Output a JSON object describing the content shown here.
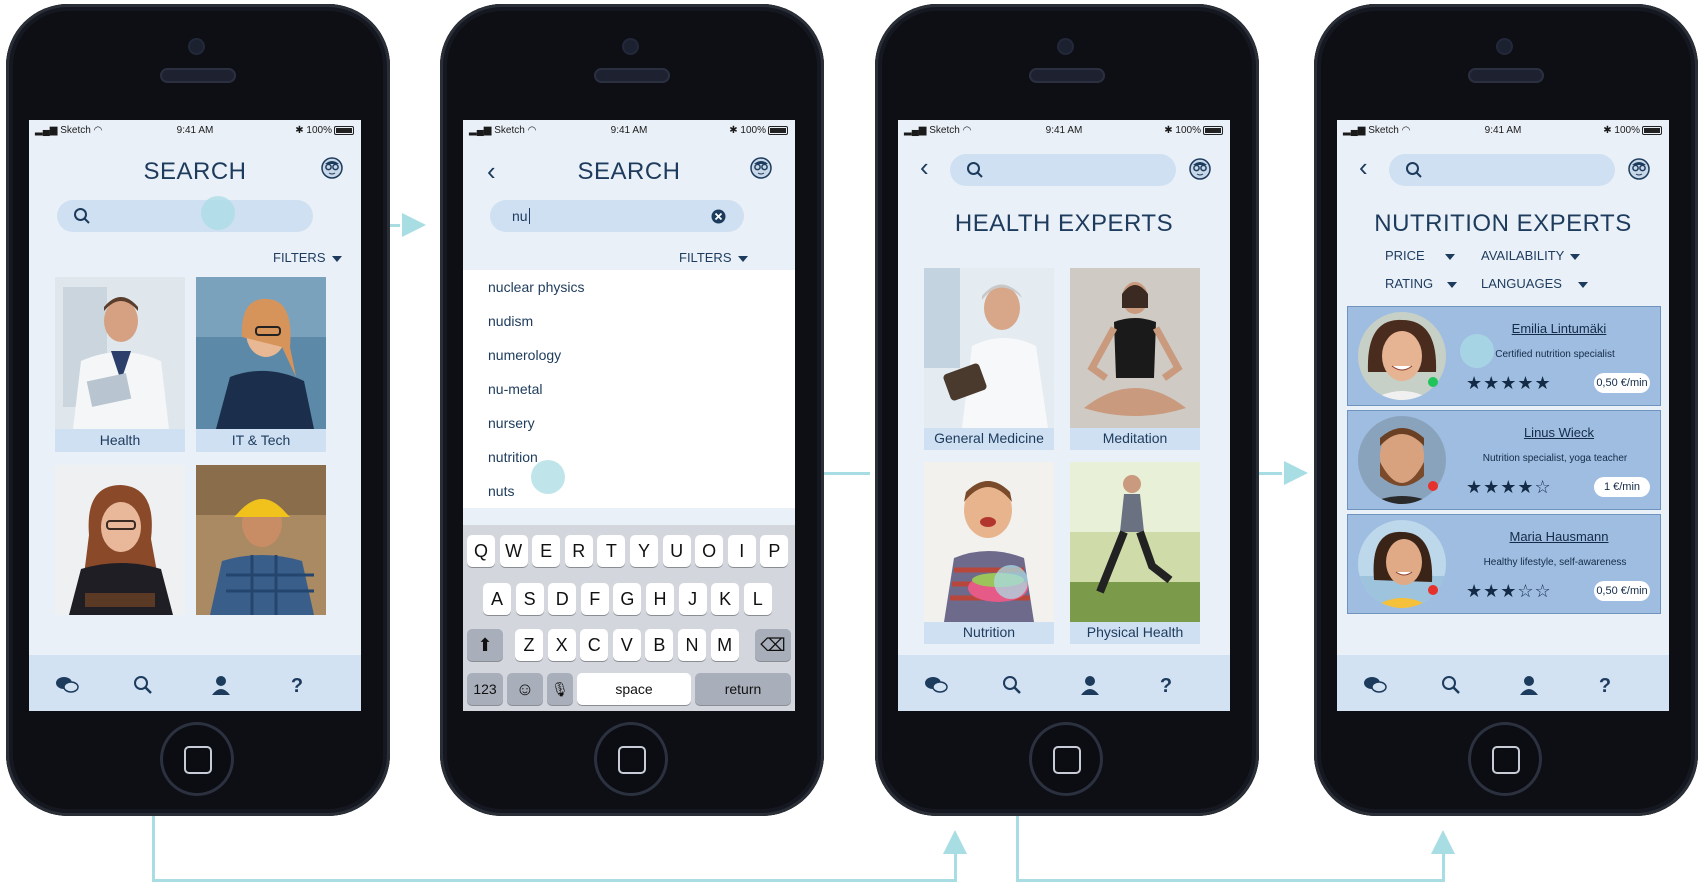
{
  "status": {
    "carrier": "Sketch",
    "time": "9:41 AM",
    "battery": "100%"
  },
  "screen1": {
    "title": "SEARCH",
    "filters_label": "FILTERS",
    "categories": [
      "Health",
      "IT & Tech"
    ]
  },
  "screen2": {
    "title": "SEARCH",
    "search_value": "nu",
    "filters_label": "FILTERS",
    "suggestions": [
      "nuclear physics",
      "nudism",
      "numerology",
      "nu-metal",
      "nursery",
      "nutrition",
      "nuts"
    ],
    "keyboard": {
      "row1": [
        "Q",
        "W",
        "E",
        "R",
        "T",
        "Y",
        "U",
        "O",
        "I",
        "P"
      ],
      "row2": [
        "A",
        "S",
        "D",
        "F",
        "G",
        "H",
        "J",
        "K",
        "L"
      ],
      "row3": [
        "Z",
        "X",
        "C",
        "V",
        "B",
        "N",
        "M"
      ],
      "num_label": "123",
      "space_label": "space",
      "return_label": "return"
    }
  },
  "screen3": {
    "title": "HEALTH EXPERTS",
    "categories": [
      "General Medicine",
      "Meditation",
      "Nutrition",
      "Physical Health"
    ]
  },
  "screen4": {
    "title": "NUTRITION EXPERTS",
    "filters": [
      "PRICE",
      "AVAILABILITY",
      "RATING",
      "LANGUAGES"
    ],
    "experts": [
      {
        "name": "Emilia Lintumäki",
        "description": "Certified nutrition specialist",
        "rating": 5,
        "price": "0,50 €/min",
        "status": "online"
      },
      {
        "name": "Linus Wieck",
        "description": "Nutrition specialist, yoga teacher",
        "rating": 4,
        "price": "1 €/min",
        "status": "busy"
      },
      {
        "name": "Maria Hausmann",
        "description": "Healthy lifestyle, self-awareness",
        "rating": 3,
        "price": "0,50 €/min",
        "status": "busy"
      }
    ]
  },
  "colors": {
    "accent": "#1d3b5c",
    "screen_bg": "#eaf0f8",
    "search_bg": "#cfe0f2",
    "card_bg": "#9fbde1",
    "flow": "#a8dde4",
    "online": "#21c35b",
    "busy": "#e5302b"
  }
}
